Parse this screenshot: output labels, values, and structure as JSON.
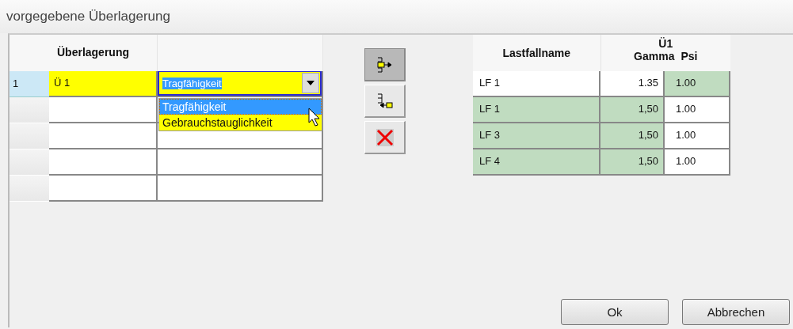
{
  "title": "vorgegebene Überlagerung",
  "grid": {
    "column": "Überlagerung",
    "rows": [
      {
        "number": "1",
        "selected": true,
        "name": "Ü 1",
        "type": "Tragfähigkeit"
      },
      {
        "selected": false
      },
      {
        "selected": false
      },
      {
        "selected": false
      },
      {
        "selected": false
      }
    ],
    "dropdown": {
      "open": true,
      "options": [
        {
          "label": "Tragfähigkeit",
          "selected": true
        },
        {
          "label": "Gebrauchstauglichkeit",
          "selected": false
        }
      ]
    }
  },
  "tools": [
    {
      "kind": "add",
      "pressed": true
    },
    {
      "kind": "remove",
      "pressed": false
    },
    {
      "kind": "delete",
      "pressed": false
    }
  ],
  "loadcases": {
    "name_header": "Lastfallname",
    "group_header": "Ü1",
    "gamma_header": "Gamma",
    "psi_header": "Psi",
    "rows": [
      {
        "name": "LF 1",
        "name_shaded": false,
        "gamma": "1.35",
        "gamma_shaded": false,
        "psi": "1.00",
        "psi_shaded": true
      },
      {
        "name": "LF 1",
        "name_shaded": true,
        "gamma": "1,50",
        "gamma_shaded": true,
        "psi": "1.00",
        "psi_shaded": false
      },
      {
        "name": "LF 3",
        "name_shaded": true,
        "gamma": "1,50",
        "gamma_shaded": true,
        "psi": "1.00",
        "psi_shaded": false
      },
      {
        "name": "LF 4",
        "name_shaded": true,
        "gamma": "1,50",
        "gamma_shaded": true,
        "psi": "1.00",
        "psi_shaded": false
      }
    ]
  },
  "buttons": [
    "Ok",
    "Abbrechen"
  ]
}
